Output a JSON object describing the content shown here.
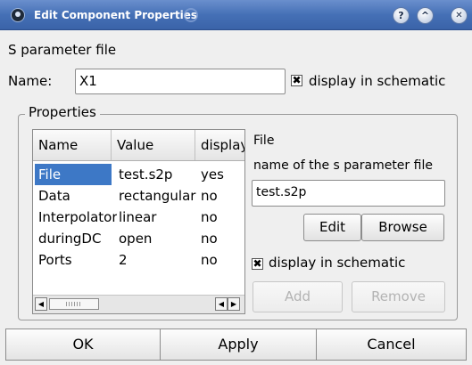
{
  "window": {
    "title": "Edit Component Properties",
    "help_button": "?",
    "collapse_button": "^",
    "close_button": "✕"
  },
  "description": "S parameter file",
  "name_row": {
    "label": "Name:",
    "value": "X1",
    "display_checked": true,
    "display_label": "display in schematic"
  },
  "properties": {
    "group_label": "Properties",
    "columns": [
      "Name",
      "Value",
      "display"
    ],
    "rows": [
      {
        "name": "File",
        "value": "test.s2p",
        "display": "yes",
        "selected": true
      },
      {
        "name": "Data",
        "value": "rectangular",
        "display": "no",
        "selected": false
      },
      {
        "name": "Interpolator",
        "value": "linear",
        "display": "no",
        "selected": false
      },
      {
        "name": "duringDC",
        "value": "open",
        "display": "no",
        "selected": false
      },
      {
        "name": "Ports",
        "value": "2",
        "display": "no",
        "selected": false
      }
    ],
    "scroll_left": "◀",
    "scroll_right": "▶"
  },
  "editor": {
    "prop_name": "File",
    "prop_description": "name of the s parameter file",
    "value": "test.s2p",
    "edit_label": "Edit",
    "browse_label": "Browse",
    "display_checked": true,
    "display_label": "display in schematic",
    "add_label": "Add",
    "remove_label": "Remove"
  },
  "footer": {
    "ok_label": "OK",
    "apply_label": "Apply",
    "cancel_label": "Cancel"
  },
  "icons": {
    "app": "qucs-app-icon",
    "check": "✖"
  }
}
